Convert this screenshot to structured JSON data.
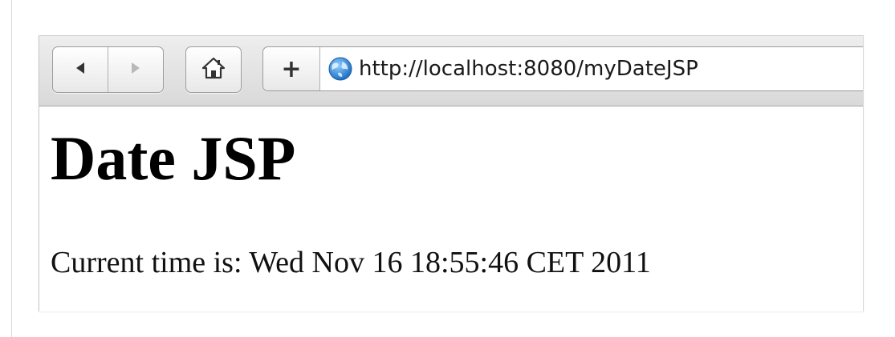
{
  "browser": {
    "url": "http://localhost:8080/myDateJSP",
    "icons": {
      "back": "back-arrow-icon",
      "forward": "forward-arrow-icon",
      "home": "home-icon",
      "add": "plus-icon",
      "site": "globe-icon"
    },
    "add_label": "+"
  },
  "page": {
    "title": "Date JSP",
    "time_text": "Current time is: Wed Nov 16 18:55:46 CET 2011"
  }
}
